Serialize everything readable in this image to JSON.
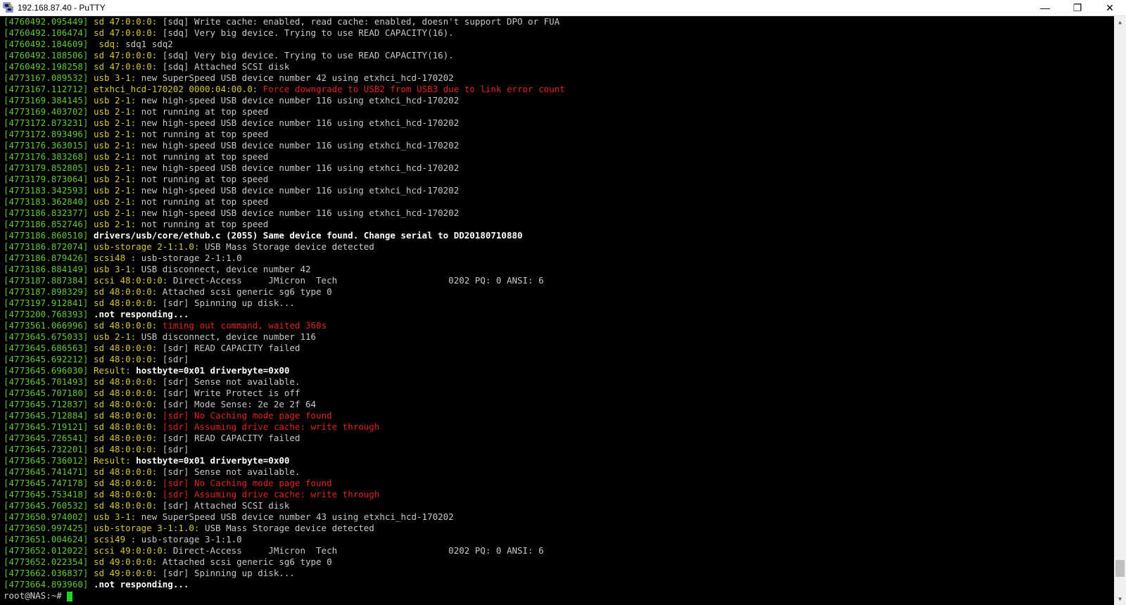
{
  "window": {
    "title": "192.168.87.40 - PuTTY",
    "icon": "putty-icon",
    "controls": {
      "minimize": "—",
      "restore": "❐",
      "close": "✕"
    }
  },
  "terminal": {
    "lines": [
      {
        "ts": "[4760492.095449]",
        "src": " sd 47:0:0:0:",
        "msg": " [sdq] Write cache: enabled, read cache: enabled, doesn't support DPO or FUA",
        "kind": "normal"
      },
      {
        "ts": "[4760492.106474]",
        "src": " sd 47:0:0:0:",
        "msg": " [sdq] Very big device. Trying to use READ CAPACITY(16).",
        "kind": "normal"
      },
      {
        "ts": "[4760492.184609]",
        "src": "  sdq:",
        "msg": " sdq1 sdq2",
        "kind": "normal"
      },
      {
        "ts": "[4760492.188506]",
        "src": " sd 47:0:0:0:",
        "msg": " [sdq] Very big device. Trying to use READ CAPACITY(16).",
        "kind": "normal"
      },
      {
        "ts": "[4760492.198258]",
        "src": " sd 47:0:0:0:",
        "msg": " [sdq] Attached SCSI disk",
        "kind": "normal"
      },
      {
        "ts": "[4773167.089532]",
        "src": " usb 3-1:",
        "msg": " new SuperSpeed USB device number 42 using etxhci_hcd-170202",
        "kind": "normal"
      },
      {
        "ts": "[4773167.112712]",
        "src": " etxhci_hcd-170202 0000:04:00.0:",
        "msg": " Force downgrade to USB2 from USB3 due to link error count",
        "kind": "error"
      },
      {
        "ts": "[4773169.384145]",
        "src": " usb 2-1:",
        "msg": " new high-speed USB device number 116 using etxhci_hcd-170202",
        "kind": "normal"
      },
      {
        "ts": "[4773169.403702]",
        "src": " usb 2-1:",
        "msg": " not running at top speed",
        "kind": "normal"
      },
      {
        "ts": "[4773172.873231]",
        "src": " usb 2-1:",
        "msg": " new high-speed USB device number 116 using etxhci_hcd-170202",
        "kind": "normal"
      },
      {
        "ts": "[4773172.893496]",
        "src": " usb 2-1:",
        "msg": " not running at top speed",
        "kind": "normal"
      },
      {
        "ts": "[4773176.363015]",
        "src": " usb 2-1:",
        "msg": " new high-speed USB device number 116 using etxhci_hcd-170202",
        "kind": "normal"
      },
      {
        "ts": "[4773176.383268]",
        "src": " usb 2-1:",
        "msg": " not running at top speed",
        "kind": "normal"
      },
      {
        "ts": "[4773179.852805]",
        "src": " usb 2-1:",
        "msg": " new high-speed USB device number 116 using etxhci_hcd-170202",
        "kind": "normal"
      },
      {
        "ts": "[4773179.873064]",
        "src": " usb 2-1:",
        "msg": " not running at top speed",
        "kind": "normal"
      },
      {
        "ts": "[4773183.342593]",
        "src": " usb 2-1:",
        "msg": " new high-speed USB device number 116 using etxhci_hcd-170202",
        "kind": "normal"
      },
      {
        "ts": "[4773183.362840]",
        "src": " usb 2-1:",
        "msg": " not running at top speed",
        "kind": "normal"
      },
      {
        "ts": "[4773186.832377]",
        "src": " usb 2-1:",
        "msg": " new high-speed USB device number 116 using etxhci_hcd-170202",
        "kind": "normal"
      },
      {
        "ts": "[4773186.852746]",
        "src": " usb 2-1:",
        "msg": " not running at top speed",
        "kind": "normal"
      },
      {
        "ts": "[4773186.860510]",
        "src": "",
        "msg": " drivers/usb/core/ethub.c (2055) Same device found. Change serial to DD20180710880",
        "kind": "bold"
      },
      {
        "ts": "[4773186.872074]",
        "src": " usb-storage 2-1:1.0:",
        "msg": " USB Mass Storage device detected",
        "kind": "normal"
      },
      {
        "ts": "[4773186.879426]",
        "src": " scsi48",
        "msg": " : usb-storage 2-1:1.0",
        "kind": "normal"
      },
      {
        "ts": "[4773186.884149]",
        "src": " usb 3-1:",
        "msg": " USB disconnect, device number 42",
        "kind": "normal"
      },
      {
        "ts": "[4773187.887384]",
        "src": " scsi 48:0:0:0:",
        "msg": " Direct-Access     JMicron  Tech                     0202 PQ: 0 ANSI: 6",
        "kind": "normal"
      },
      {
        "ts": "[4773187.898329]",
        "src": " sd 48:0:0:0:",
        "msg": " Attached scsi generic sg6 type 0",
        "kind": "normal"
      },
      {
        "ts": "[4773197.912841]",
        "src": " sd 48:0:0:0:",
        "msg": " [sdr] Spinning up disk...",
        "kind": "normal"
      },
      {
        "ts": "[4773200.768393]",
        "src": "",
        "msg": " .not responding...",
        "kind": "bold"
      },
      {
        "ts": "[4773561.066996]",
        "src": " sd 48:0:0:0:",
        "msg": " timing out command, waited 360s",
        "kind": "error"
      },
      {
        "ts": "[4773645.675033]",
        "src": " usb 2-1:",
        "msg": " USB disconnect, device number 116",
        "kind": "normal"
      },
      {
        "ts": "[4773645.686563]",
        "src": " sd 48:0:0:0:",
        "msg": " [sdr] READ CAPACITY failed",
        "kind": "normal"
      },
      {
        "ts": "[4773645.692212]",
        "src": " sd 48:0:0:0:",
        "msg": " [sdr]",
        "kind": "normal"
      },
      {
        "ts": "[4773645.696030]",
        "src": " Result:",
        "msg": " hostbyte=0x01 driverbyte=0x00",
        "kind": "boldmsg"
      },
      {
        "ts": "[4773645.701493]",
        "src": " sd 48:0:0:0:",
        "msg": " [sdr] Sense not available.",
        "kind": "normal"
      },
      {
        "ts": "[4773645.707180]",
        "src": " sd 48:0:0:0:",
        "msg": " [sdr] Write Protect is off",
        "kind": "normal"
      },
      {
        "ts": "[4773645.712837]",
        "src": " sd 48:0:0:0:",
        "msg": " [sdr] Mode Sense: 2e 2e 2f 64",
        "kind": "normal"
      },
      {
        "ts": "[4773645.712884]",
        "src": " sd 48:0:0:0:",
        "msg": " [sdr] No Caching mode page found",
        "kind": "error"
      },
      {
        "ts": "[4773645.719121]",
        "src": " sd 48:0:0:0:",
        "msg": " [sdr] Assuming drive cache: write through",
        "kind": "error"
      },
      {
        "ts": "[4773645.726541]",
        "src": " sd 48:0:0:0:",
        "msg": " [sdr] READ CAPACITY failed",
        "kind": "normal"
      },
      {
        "ts": "[4773645.732201]",
        "src": " sd 48:0:0:0:",
        "msg": " [sdr]",
        "kind": "normal"
      },
      {
        "ts": "[4773645.736012]",
        "src": " Result:",
        "msg": " hostbyte=0x01 driverbyte=0x00",
        "kind": "boldmsg"
      },
      {
        "ts": "[4773645.741471]",
        "src": " sd 48:0:0:0:",
        "msg": " [sdr] Sense not available.",
        "kind": "normal"
      },
      {
        "ts": "[4773645.747178]",
        "src": " sd 48:0:0:0:",
        "msg": " [sdr] No Caching mode page found",
        "kind": "error"
      },
      {
        "ts": "[4773645.753418]",
        "src": " sd 48:0:0:0:",
        "msg": " [sdr] Assuming drive cache: write through",
        "kind": "error"
      },
      {
        "ts": "[4773645.760532]",
        "src": " sd 48:0:0:0:",
        "msg": " [sdr] Attached SCSI disk",
        "kind": "normal"
      },
      {
        "ts": "[4773650.974002]",
        "src": " usb 3-1:",
        "msg": " new SuperSpeed USB device number 43 using etxhci_hcd-170202",
        "kind": "normal"
      },
      {
        "ts": "[4773650.997425]",
        "src": " usb-storage 3-1:1.0:",
        "msg": " USB Mass Storage device detected",
        "kind": "normal"
      },
      {
        "ts": "[4773651.004624]",
        "src": " scsi49",
        "msg": " : usb-storage 3-1:1.0",
        "kind": "normal"
      },
      {
        "ts": "[4773652.012022]",
        "src": " scsi 49:0:0:0:",
        "msg": " Direct-Access     JMicron  Tech                     0202 PQ: 0 ANSI: 6",
        "kind": "normal"
      },
      {
        "ts": "[4773652.022354]",
        "src": " sd 49:0:0:0:",
        "msg": " Attached scsi generic sg6 type 0",
        "kind": "normal"
      },
      {
        "ts": "[4773662.036837]",
        "src": " sd 49:0:0:0:",
        "msg": " [sdr] Spinning up disk...",
        "kind": "normal"
      },
      {
        "ts": "[4773664.893960]",
        "src": "",
        "msg": " .not responding...",
        "kind": "bold"
      }
    ],
    "prompt": "root@NAS:~# "
  },
  "scrollbar": {
    "thumb_position_fraction": 0.97,
    "thumb_size_fraction": 0.03
  },
  "colors": {
    "background": "#000000",
    "timestamp": "#5cc92e",
    "source": "#d7c733",
    "message": "#c8c8c8",
    "error": "#e02222",
    "cursor": "#23d423"
  }
}
